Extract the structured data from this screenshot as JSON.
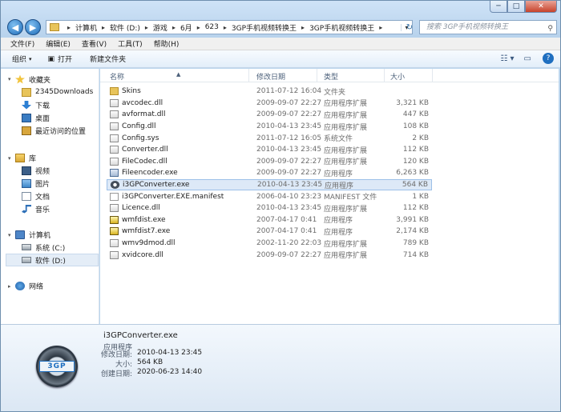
{
  "window": {
    "controls": {
      "minimize": "─",
      "maximize": "□",
      "close": "✕"
    },
    "accent": "#1f6fc0"
  },
  "address": {
    "crumbs": [
      "计算机",
      "软件 (D:)",
      "游戏",
      "6月",
      "623",
      "3GP手机视频转换王",
      "3GP手机视频转换王"
    ],
    "search_placeholder": "搜索 3GP手机视频转换王"
  },
  "menu": [
    "文件(F)",
    "编辑(E)",
    "查看(V)",
    "工具(T)",
    "帮助(H)"
  ],
  "toolbar": {
    "organize": "组织",
    "open": "打开",
    "new_folder": "新建文件夹"
  },
  "nav": {
    "favorites": {
      "label": "收藏夹",
      "items": [
        "2345Downloads",
        "下载",
        "桌面",
        "最近访问的位置"
      ]
    },
    "library": {
      "label": "库",
      "items": [
        "视频",
        "图片",
        "文档",
        "音乐"
      ]
    },
    "computer": {
      "label": "计算机",
      "items": [
        "系统 (C:)",
        "软件 (D:)"
      ]
    },
    "network": {
      "label": "网络"
    }
  },
  "columns": [
    "名称",
    "修改日期",
    "类型",
    "大小"
  ],
  "files": [
    {
      "name": "Skins",
      "date": "2011-07-12 16:04",
      "type": "文件夹",
      "size": "",
      "icon": "folder"
    },
    {
      "name": "avcodec.dll",
      "date": "2009-09-07 22:27",
      "type": "应用程序扩展",
      "size": "3,321 KB",
      "icon": "dll"
    },
    {
      "name": "avformat.dll",
      "date": "2009-09-07 22:27",
      "type": "应用程序扩展",
      "size": "447 KB",
      "icon": "dll"
    },
    {
      "name": "Config.dll",
      "date": "2010-04-13 23:45",
      "type": "应用程序扩展",
      "size": "108 KB",
      "icon": "dll"
    },
    {
      "name": "Config.sys",
      "date": "2011-07-12 16:05",
      "type": "系统文件",
      "size": "2 KB",
      "icon": "sys"
    },
    {
      "name": "Converter.dll",
      "date": "2010-04-13 23:45",
      "type": "应用程序扩展",
      "size": "112 KB",
      "icon": "dll"
    },
    {
      "name": "FileCodec.dll",
      "date": "2009-09-07 22:27",
      "type": "应用程序扩展",
      "size": "120 KB",
      "icon": "dll"
    },
    {
      "name": "Fileencoder.exe",
      "date": "2009-09-07 22:27",
      "type": "应用程序",
      "size": "6,263 KB",
      "icon": "exe"
    },
    {
      "name": "i3GPConverter.exe",
      "date": "2010-04-13 23:45",
      "type": "应用程序",
      "size": "564 KB",
      "icon": "3gp",
      "selected": true
    },
    {
      "name": "i3GPConverter.EXE.manifest",
      "date": "2006-04-10 23:23",
      "type": "MANIFEST 文件",
      "size": "1 KB",
      "icon": "manifest"
    },
    {
      "name": "Licence.dll",
      "date": "2010-04-13 23:45",
      "type": "应用程序扩展",
      "size": "112 KB",
      "icon": "dll"
    },
    {
      "name": "wmfdist.exe",
      "date": "2007-04-17 0:41",
      "type": "应用程序",
      "size": "3,991 KB",
      "icon": "wmf"
    },
    {
      "name": "wmfdist7.exe",
      "date": "2007-04-17 0:41",
      "type": "应用程序",
      "size": "2,174 KB",
      "icon": "wmf"
    },
    {
      "name": "wmv9dmod.dll",
      "date": "2002-11-20 22:03",
      "type": "应用程序扩展",
      "size": "789 KB",
      "icon": "dll"
    },
    {
      "name": "xvidcore.dll",
      "date": "2009-09-07 22:27",
      "type": "应用程序扩展",
      "size": "714 KB",
      "icon": "dll"
    }
  ],
  "details": {
    "badge": "3GP",
    "name": "i3GPConverter.exe",
    "type": "应用程序",
    "modified_label": "修改日期:",
    "modified": "2010-04-13 23:45",
    "size_label": "大小:",
    "size": "564 KB",
    "created_label": "创建日期:",
    "created": "2020-06-23 14:40"
  }
}
